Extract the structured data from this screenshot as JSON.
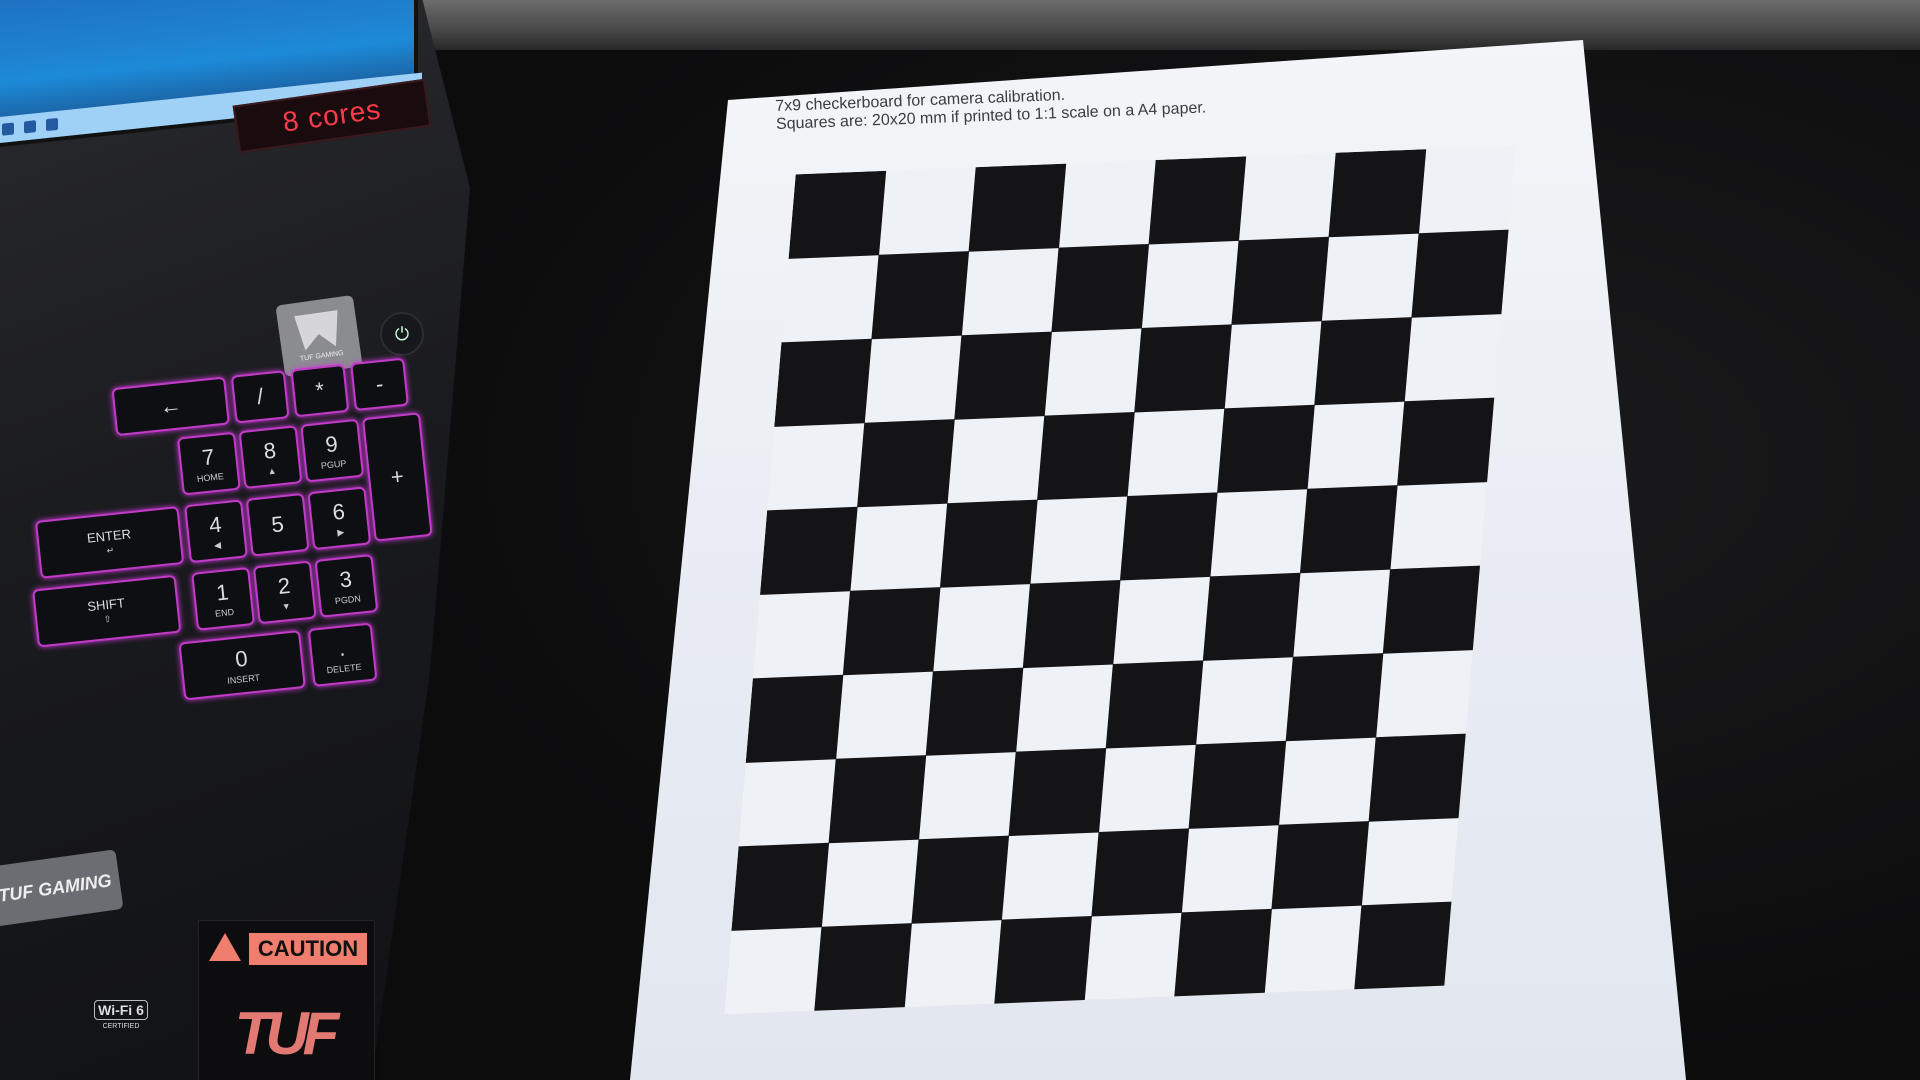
{
  "paper": {
    "caption_line1": "7x9 checkerboard for camera calibration.",
    "caption_line2": "Squares are: 20x20 mm if printed to 1:1 scale on a A4 paper.",
    "checkerboard": {
      "rows": 10,
      "cols": 8,
      "first_dark_col_row0": 0
    }
  },
  "laptop": {
    "cores_badge": "8 cores",
    "tuf_plate_text": "TUF GAMING",
    "tuf_sticker": "TUF GAMING",
    "caution_text": "CAUTION",
    "caution_art": "TUF",
    "wifi_label": "Wi-Fi 6",
    "wifi_sub": "CERTIFIED",
    "keys": [
      {
        "label": "←",
        "sub": ""
      },
      {
        "label": "/",
        "sub": ""
      },
      {
        "label": "*",
        "sub": ""
      },
      {
        "label": "-",
        "sub": ""
      },
      {
        "label": "7",
        "sub": "HOME"
      },
      {
        "label": "8",
        "sub": "▲"
      },
      {
        "label": "9",
        "sub": "PGUP"
      },
      {
        "label": "+",
        "sub": ""
      },
      {
        "label": "ENTER",
        "sub": "↵"
      },
      {
        "label": "4",
        "sub": "◀"
      },
      {
        "label": "5",
        "sub": ""
      },
      {
        "label": "6",
        "sub": "▶"
      },
      {
        "label": "SHIFT",
        "sub": "⇧"
      },
      {
        "label": "1",
        "sub": "END"
      },
      {
        "label": "2",
        "sub": "▼"
      },
      {
        "label": "3",
        "sub": "PGDN"
      },
      {
        "label": "0",
        "sub": "INSERT"
      },
      {
        "label": ".",
        "sub": "DELETE"
      }
    ]
  }
}
